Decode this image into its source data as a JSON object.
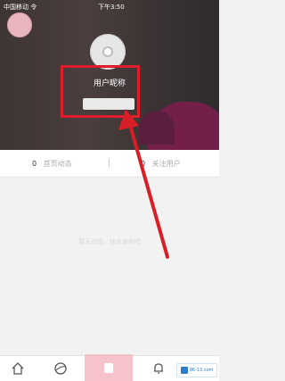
{
  "status_bar": {
    "carrier": "中国移动 令",
    "time": "下午3:50"
  },
  "profile": {
    "nickname": "用户昵称",
    "login_button_label": ""
  },
  "stats": [
    {
      "count": "0",
      "label": "首页动态"
    },
    {
      "count": "0",
      "label": "关注用户"
    }
  ],
  "empty_hint": "暂无动态，快去发布吧",
  "watermark": {
    "text": "96-13.com"
  },
  "colors": {
    "highlight": "#e01e2b",
    "center_tab": "#f6c3cd",
    "hero_bg": "#3e3433"
  },
  "icons": [
    "home-icon",
    "discover-icon",
    "publish-icon",
    "bell-icon"
  ]
}
